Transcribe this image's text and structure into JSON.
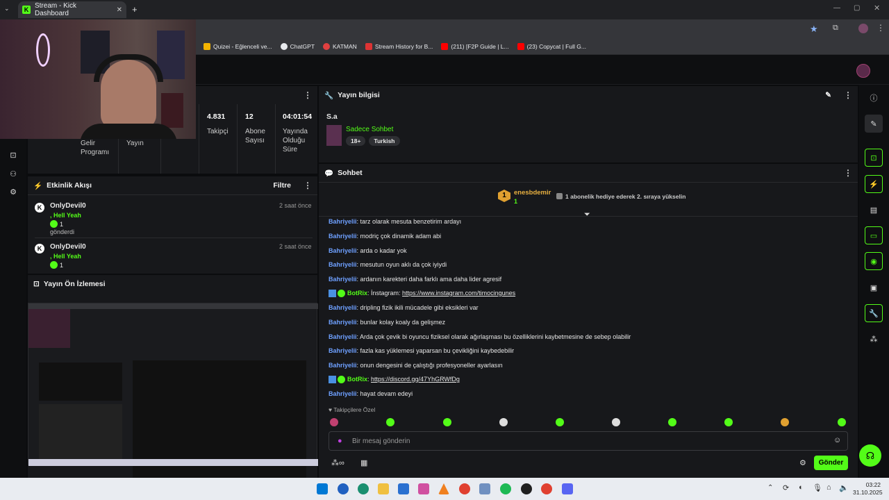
{
  "browser": {
    "tab_title": "Stream - Kick Dashboard",
    "bookmarks": [
      {
        "label": "Quizei - Eğlenceli ve...",
        "color": "#f4b400"
      },
      {
        "label": "ChatGPT",
        "color": "#e8eaed"
      },
      {
        "label": "KATMAN",
        "color": "#e04040"
      },
      {
        "label": "Stream History for B...",
        "color": "#d33"
      },
      {
        "label": "(211) [F2P Guide | L...",
        "color": "#ff0000"
      },
      {
        "label": "(23) Copycat | Full G...",
        "color": "#ff0000"
      }
    ]
  },
  "stats": {
    "income_label": "Gelir Programı",
    "broadcast_label": "Yayın",
    "followers_value": "4.831",
    "followers_label": "Takipçi",
    "subs_value": "12",
    "subs_label": "Abone Sayısı",
    "uptime_value": "04:01:54",
    "uptime_label": "Yayında Olduğu Süre"
  },
  "stream_info": {
    "title": "Yayın bilgisi",
    "stream_title": "S.a",
    "category": "Sadece Sohbet",
    "tags": [
      "18+",
      "Turkish"
    ]
  },
  "activity": {
    "title": "Etkinlik Akışı",
    "filter_label": "Filtre",
    "items": [
      {
        "user": "OnlyDevil0",
        "msg": ", Hell Yeah",
        "count": "1",
        "extra": "gönderdi",
        "time": "2 saat önce"
      },
      {
        "user": "OnlyDevil0",
        "msg": ", Hell Yeah",
        "count": "1",
        "extra": "",
        "time": "2 saat önce"
      }
    ]
  },
  "preview": {
    "title": "Yayın Ön İzlemesi"
  },
  "chat": {
    "title": "Sohbet",
    "pinned_user": "enesbdemir",
    "pinned_count": "1",
    "pinned_badge": "1",
    "pinned_text": "1 abonelik hediye ederek 2. sıraya yükselin",
    "messages": [
      {
        "user": "Bahriyelii",
        "text": "tarz olarak mesuta benzetirim ardayı",
        "bot": false
      },
      {
        "user": "Bahriyelii",
        "text": "modriç çok dinamik adam abi",
        "bot": false
      },
      {
        "user": "Bahriyelii",
        "text": "arda o kadar yok",
        "bot": false
      },
      {
        "user": "Bahriyelii",
        "text": "mesutun oyun aklı da çok iyiydi",
        "bot": false
      },
      {
        "user": "Bahriyelii",
        "text": "ardanın karekteri daha farklı ama daha lider agresif",
        "bot": false
      },
      {
        "user": "BotRix",
        "text": "İnstagram: ",
        "link": "https://www.instagram.com/timocingunes",
        "bot": true
      },
      {
        "user": "Bahriyelii",
        "text": "dripling fizik ikili mücadele gibi eksikleri var",
        "bot": false
      },
      {
        "user": "Bahriyelii",
        "text": "bunlar kolay koaly da gelişmez",
        "bot": false
      },
      {
        "user": "Bahriyelii",
        "text": "Arda çok çevik bi oyuncu fiziksel olarak ağırlaşması bu özelliklerini kaybetmesine de sebep olabilir",
        "bot": false
      },
      {
        "user": "Bahriyelii",
        "text": "fazla kas yüklemesi yaparsan bu çevikliğini kaybedebilir",
        "bot": false
      },
      {
        "user": "Bahriyelii",
        "text": "onun dengesini de çalıştığı profesyoneller ayarlasın",
        "bot": false
      },
      {
        "user": "BotRix",
        "text": "",
        "link": "https://discord.gg/47YhGRWfDg",
        "bot": true
      },
      {
        "user": "Bahriyelii",
        "text": "hayat devam edeyi",
        "bot": false
      }
    ],
    "followers_only": "Takipçilere Özel",
    "input_placeholder": "Bir mesaj gönderin",
    "send_label": "Gönder"
  },
  "taskbar": {
    "time": "03:22",
    "date": "31.10.2025"
  }
}
